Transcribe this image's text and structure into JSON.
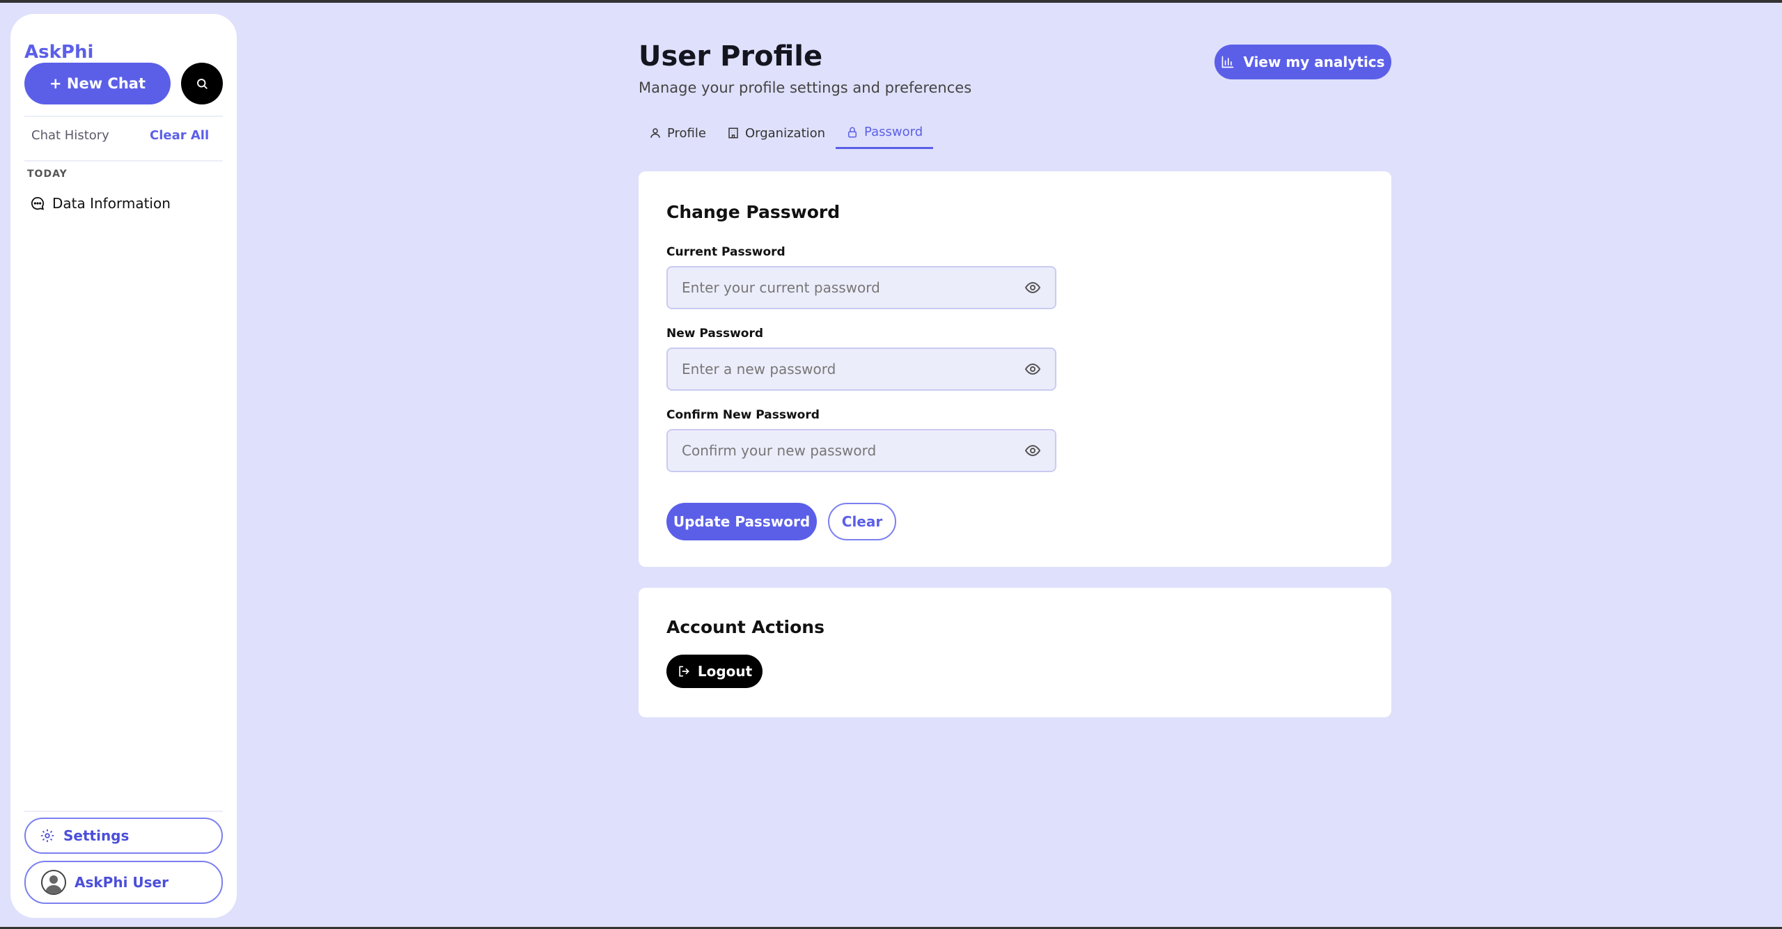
{
  "sidebar": {
    "logo": "AskPhi",
    "new_chat_label": "+ New Chat",
    "history_label": "Chat History",
    "clear_all_label": "Clear All",
    "section_today": "TODAY",
    "history_items": [
      {
        "label": "Data Information",
        "icon": "chat-bubble-icon"
      }
    ],
    "settings_label": "Settings",
    "user_label": "AskPhi User"
  },
  "header": {
    "title": "User Profile",
    "subtitle": "Manage your profile settings and preferences",
    "analytics_button": "View my analytics"
  },
  "tabs": [
    {
      "label": "Profile",
      "icon": "user-icon",
      "active": false
    },
    {
      "label": "Organization",
      "icon": "building-icon",
      "active": false
    },
    {
      "label": "Password",
      "icon": "lock-icon",
      "active": true
    }
  ],
  "change_password": {
    "title": "Change Password",
    "fields": [
      {
        "label": "Current Password",
        "placeholder": "Enter your current password",
        "value": ""
      },
      {
        "label": "New Password",
        "placeholder": "Enter a new password",
        "value": ""
      },
      {
        "label": "Confirm New Password",
        "placeholder": "Confirm your new password",
        "value": ""
      }
    ],
    "update_button": "Update Password",
    "clear_button": "Clear"
  },
  "account_actions": {
    "title": "Account Actions",
    "logout_button": "Logout"
  },
  "colors": {
    "accent": "#5b5fe8",
    "background": "#dfe0fb",
    "card": "#ffffff",
    "input_bg": "#ecedfb"
  }
}
